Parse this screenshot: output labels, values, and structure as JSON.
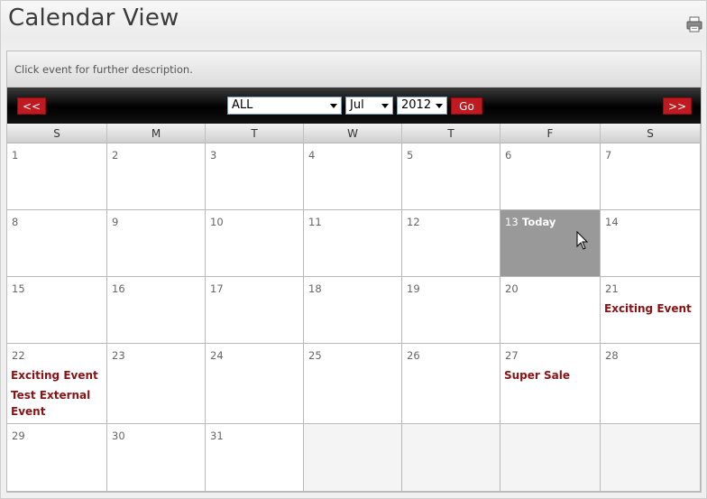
{
  "header": {
    "title": "Calendar View",
    "print_icon": "printer-icon"
  },
  "info": {
    "text": "Click event for further description."
  },
  "nav": {
    "prev_label": "<<",
    "next_label": ">>",
    "category": {
      "value": "ALL"
    },
    "month": {
      "value": "Jul"
    },
    "year": {
      "value": "2012"
    },
    "go_label": "Go"
  },
  "days_of_week": [
    "S",
    "M",
    "T",
    "W",
    "T",
    "F",
    "S"
  ],
  "today_label": "Today",
  "weeks": [
    [
      {
        "day": "1",
        "events": []
      },
      {
        "day": "2",
        "events": []
      },
      {
        "day": "3",
        "events": []
      },
      {
        "day": "4",
        "events": []
      },
      {
        "day": "5",
        "events": []
      },
      {
        "day": "6",
        "events": []
      },
      {
        "day": "7",
        "events": []
      }
    ],
    [
      {
        "day": "8",
        "events": []
      },
      {
        "day": "9",
        "events": []
      },
      {
        "day": "10",
        "events": []
      },
      {
        "day": "11",
        "events": []
      },
      {
        "day": "12",
        "events": []
      },
      {
        "day": "13",
        "events": [],
        "today": true
      },
      {
        "day": "14",
        "events": []
      }
    ],
    [
      {
        "day": "15",
        "events": []
      },
      {
        "day": "16",
        "events": []
      },
      {
        "day": "17",
        "events": []
      },
      {
        "day": "18",
        "events": []
      },
      {
        "day": "19",
        "events": []
      },
      {
        "day": "20",
        "events": []
      },
      {
        "day": "21",
        "events": [
          "Exciting Event"
        ]
      }
    ],
    [
      {
        "day": "22",
        "events": [
          "Exciting Event",
          "Test External Event"
        ]
      },
      {
        "day": "23",
        "events": []
      },
      {
        "day": "24",
        "events": []
      },
      {
        "day": "25",
        "events": []
      },
      {
        "day": "26",
        "events": []
      },
      {
        "day": "27",
        "events": [
          "Super Sale"
        ]
      },
      {
        "day": "28",
        "events": []
      }
    ],
    [
      {
        "day": "29",
        "events": []
      },
      {
        "day": "30",
        "events": []
      },
      {
        "day": "31",
        "events": []
      },
      {
        "day": "",
        "events": [],
        "empty": true
      },
      {
        "day": "",
        "events": [],
        "empty": true
      },
      {
        "day": "",
        "events": [],
        "empty": true
      },
      {
        "day": "",
        "events": [],
        "empty": true
      }
    ]
  ],
  "colors": {
    "nav_button": "#c0191f",
    "event_text": "#8b1114",
    "today_bg": "#999999"
  }
}
